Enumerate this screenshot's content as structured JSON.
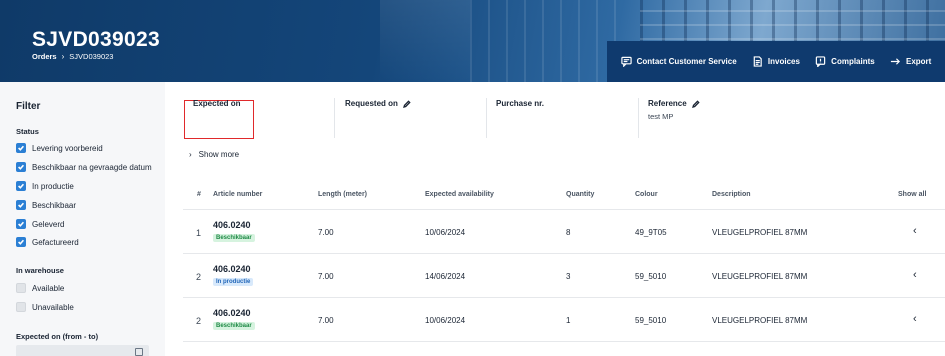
{
  "header": {
    "title": "SJVD039023",
    "breadcrumb": {
      "root": "Orders",
      "separator": "›",
      "current": "SJVD039023"
    },
    "actions": [
      {
        "label": "Contact Customer Service",
        "icon": "chat-icon"
      },
      {
        "label": "Invoices",
        "icon": "invoice-icon"
      },
      {
        "label": "Complaints",
        "icon": "complaint-icon"
      },
      {
        "label": "Export",
        "icon": "export-icon"
      }
    ]
  },
  "sidebar": {
    "title": "Filter",
    "status_label": "Status",
    "status_options": [
      {
        "label": "Levering voorbereid",
        "checked": true
      },
      {
        "label": "Beschikbaar na gevraagde datum",
        "checked": true
      },
      {
        "label": "In productie",
        "checked": true
      },
      {
        "label": "Beschikbaar",
        "checked": true
      },
      {
        "label": "Geleverd",
        "checked": true
      },
      {
        "label": "Gefactureerd",
        "checked": true
      }
    ],
    "warehouse_label": "In warehouse",
    "warehouse_options": [
      {
        "label": "Available",
        "checked": false
      },
      {
        "label": "Unavailable",
        "checked": false
      }
    ],
    "expected_label": "Expected on (from - to)"
  },
  "info": {
    "expected_on": {
      "label": "Expected on",
      "value": ""
    },
    "requested_on": {
      "label": "Requested on",
      "value": ""
    },
    "purchase_nr": {
      "label": "Purchase nr.",
      "value": ""
    },
    "reference": {
      "label": "Reference",
      "value": "test MP"
    },
    "show_more": "Show more"
  },
  "table": {
    "headers": {
      "index": "#",
      "article": "Article number",
      "length": "Length (meter)",
      "availability": "Expected availability",
      "quantity": "Quantity",
      "colour": "Colour",
      "description": "Description",
      "show_all": "Show all"
    },
    "rows": [
      {
        "index": "1",
        "article": "406.0240",
        "status": "Beschikbaar",
        "length": "7.00",
        "availability": "10/06/2024",
        "quantity": "8",
        "colour": "49_9T05",
        "description": "VLEUGELPROFIEL 87MM"
      },
      {
        "index": "2",
        "article": "406.0240",
        "status": "In productie",
        "length": "7.00",
        "availability": "14/06/2024",
        "quantity": "3",
        "colour": "59_5010",
        "description": "VLEUGELPROFIEL 87MM"
      },
      {
        "index": "2",
        "article": "406.0240",
        "status": "Beschikbaar",
        "length": "7.00",
        "availability": "10/06/2024",
        "quantity": "1",
        "colour": "59_5010",
        "description": "VLEUGELPROFIEL 87MM"
      }
    ]
  },
  "colors": {
    "header_bg": "#14467a",
    "action_bar": "#0f3a6e",
    "checkbox": "#2b7fd4",
    "highlight": "#e0292b",
    "badge_green": "#1f8a46",
    "badge_blue": "#2166b8"
  }
}
